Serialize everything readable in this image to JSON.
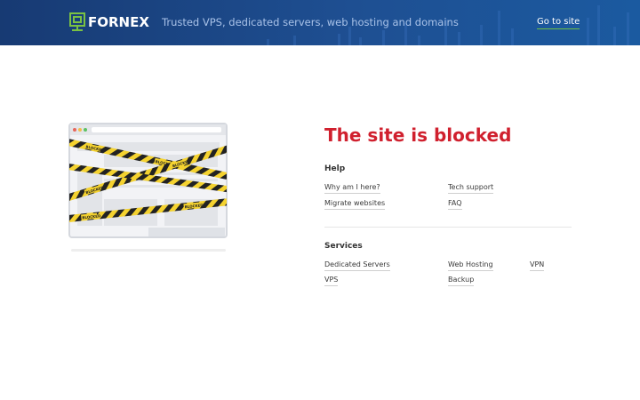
{
  "header": {
    "brand": "FORNEX",
    "tagline": "Trusted VPS, dedicated servers, web hosting and domains",
    "goto_label": "Go to site",
    "bg_color": "#1b4686",
    "link_underline_color": "#6fbf44"
  },
  "main": {
    "title": "The site is blocked",
    "title_color": "#d0202e",
    "help": {
      "heading": "Help",
      "links": [
        "Why am I here?",
        "Tech support",
        "Migrate websites",
        "FAQ"
      ]
    },
    "services": {
      "heading": "Services",
      "links": [
        "Dedicated Servers",
        "Web Hosting",
        "VPN",
        "VPS",
        "Backup"
      ]
    },
    "illustration": {
      "tape_label": "BLOCKED",
      "tape_colors": [
        "#f4d22f",
        "#222222"
      ]
    }
  }
}
